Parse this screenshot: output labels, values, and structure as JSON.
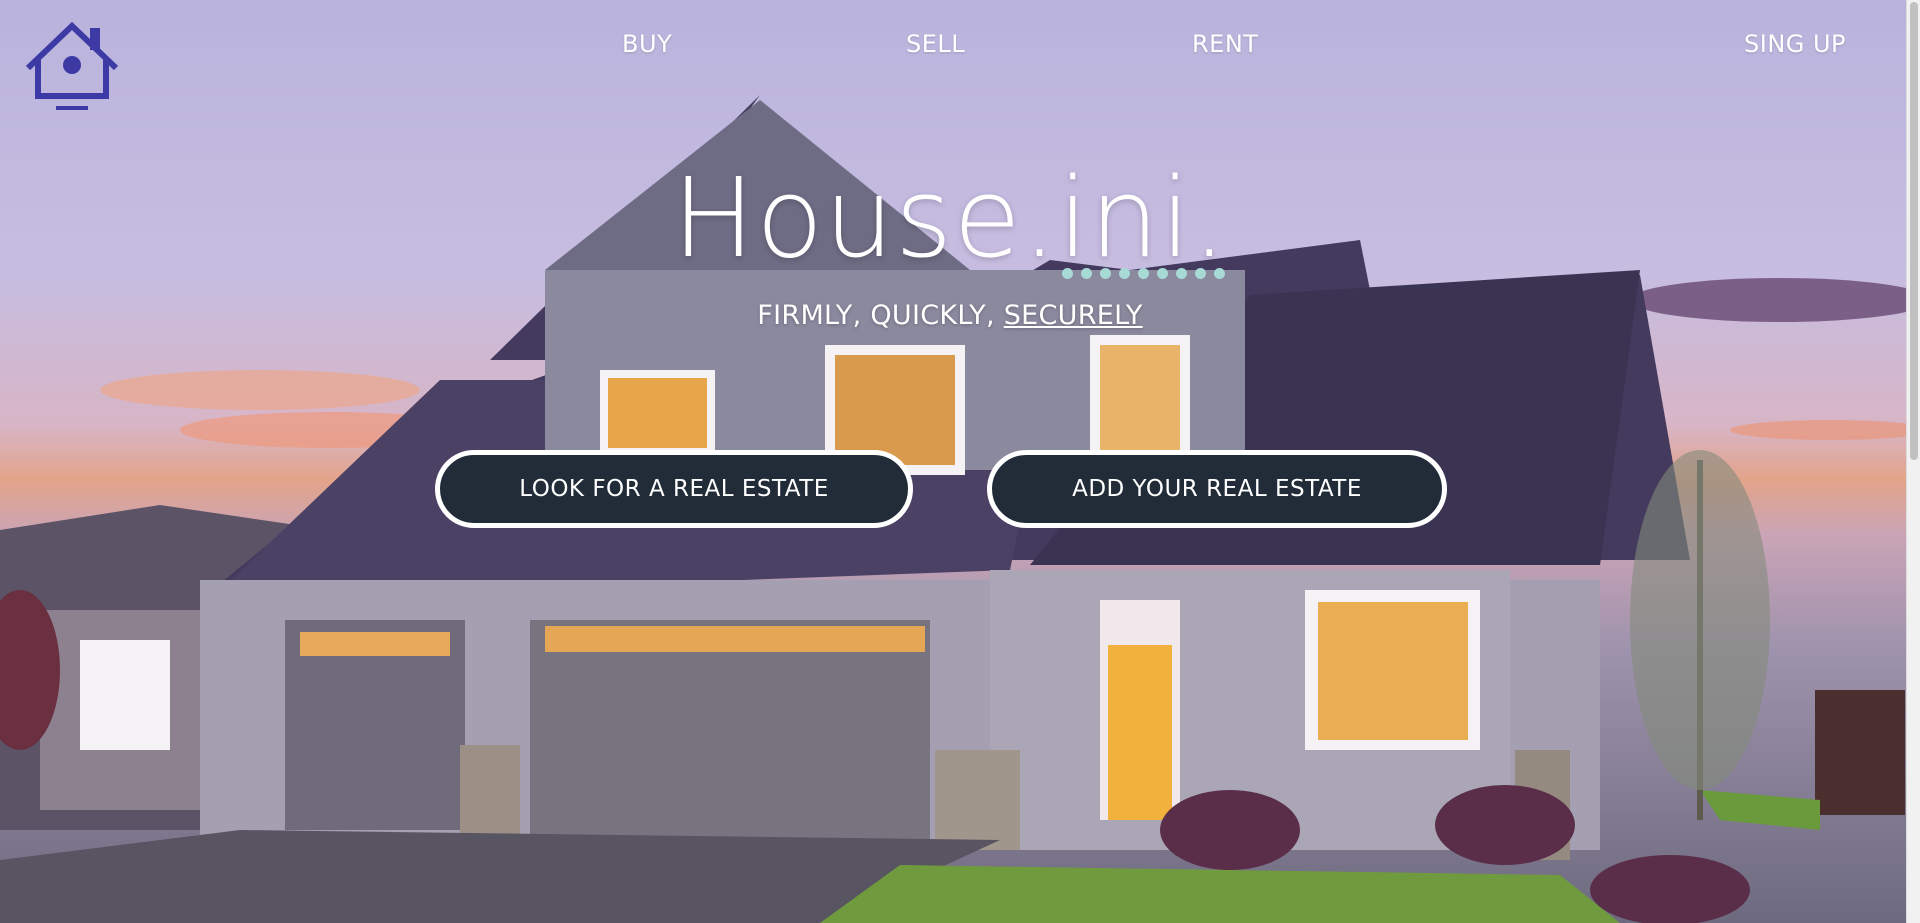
{
  "nav": {
    "logo_icon": "house-icon",
    "links": [
      {
        "label": "BUY"
      },
      {
        "label": "SELL"
      },
      {
        "label": "RENT"
      },
      {
        "label": "SING UP"
      }
    ]
  },
  "hero": {
    "title": "House.ini.",
    "tagline_part1": "FIRMLY, QUICKLY, ",
    "tagline_part2": "SECURELY",
    "buttons": {
      "look_label": "LOOK FOR A REAL ESTATE",
      "add_label": "ADD YOUR REAL ESTATE"
    }
  },
  "colors": {
    "logo": "#3d3aa6",
    "button_bg": "#212c38",
    "dots": "#a7d9d5",
    "text": "#ffffff"
  }
}
